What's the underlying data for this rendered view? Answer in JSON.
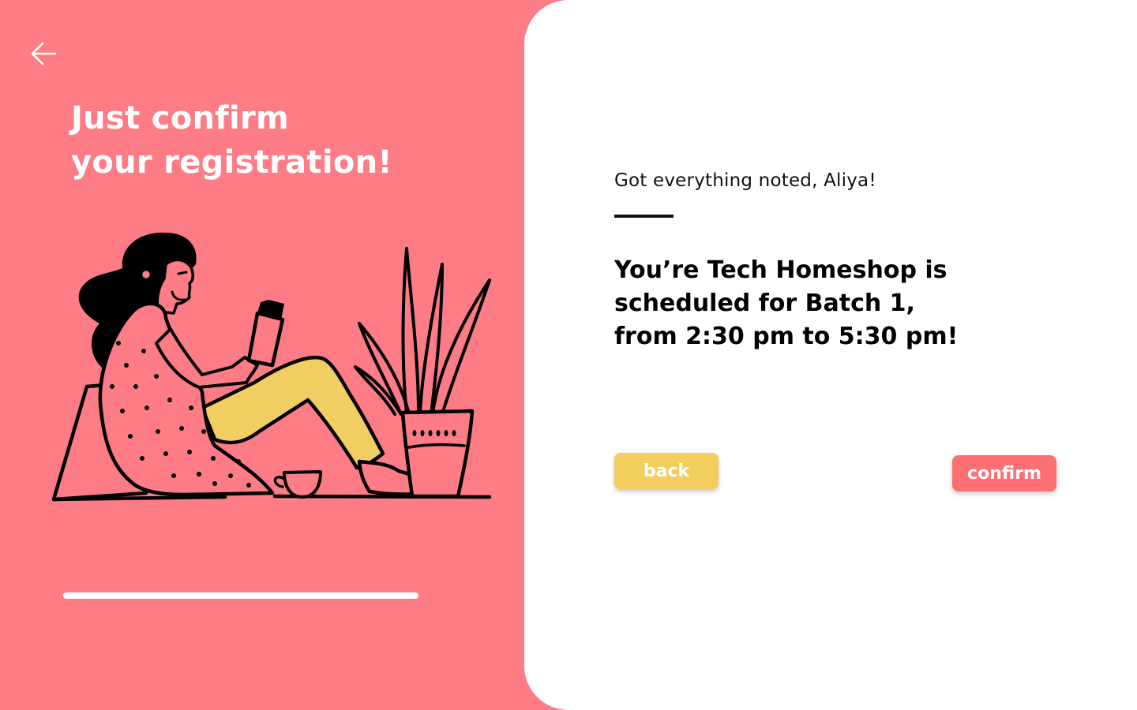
{
  "header": {
    "back_icon": "arrow-left-icon",
    "title_line1": "Just confirm",
    "title_line2": "your registration!"
  },
  "illustration": {
    "subject": "woman-reading-with-plant-icon"
  },
  "progress": {
    "value_percent": 100
  },
  "main": {
    "greeting": "Got everything noted, Aliya!",
    "schedule_line1": "You’re Tech Homeshop is",
    "schedule_line2": "scheduled for Batch 1,",
    "schedule_line3": "from 2:30 pm to 5:30 pm!"
  },
  "actions": {
    "back_label": "back",
    "confirm_label": "confirm"
  },
  "colors": {
    "background_pink": "#fe7c86",
    "card_white": "#ffffff",
    "back_button_yellow": "#f3cd5e",
    "confirm_button_red": "#fe6f73",
    "pants_yellow": "#f2cd62",
    "outline_black": "#000000"
  }
}
